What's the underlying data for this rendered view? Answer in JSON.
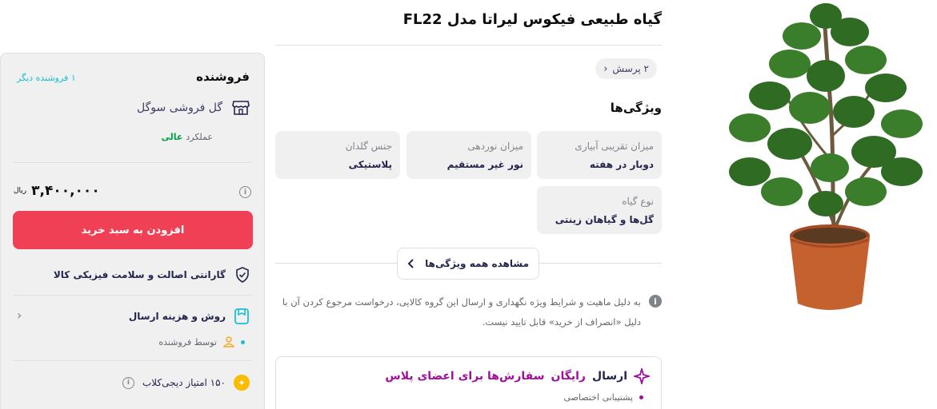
{
  "product": {
    "title": "گیاه طبیعی فیکوس لیراتا مدل FL22",
    "questions_pill": "۲ پرسش",
    "image_alt": "ficus-lyrata-plant-image"
  },
  "specs": {
    "section_title": "ویژگی‌ها",
    "items": [
      {
        "key": "میزان تقریبی آبیاری",
        "value": "دوبار در هفته"
      },
      {
        "key": "میزان نوردهی",
        "value": "نور غیر مستقیم"
      },
      {
        "key": "جنس گلدان",
        "value": "پلاستیکی"
      },
      {
        "key": "نوع گیاه",
        "value": "گل‌ها و گیاهان زینتی"
      }
    ],
    "see_all_label": "مشاهده همه ویژگی‌ها"
  },
  "notice": {
    "text": "به دلیل ماهیت و شرایط ویژه نگهداری و ارسال این گروه کالایی، درخواست مرجوع کردن آن با دلیل «انصراف از خرید» قابل تایید نیست."
  },
  "plus": {
    "heading_prefix": "ارسال",
    "heading_highlight": "رایگان",
    "heading_suffix": "سفارش‌ها برای اعضای پلاس",
    "sub_item": "پشتیبانی اختصاصی"
  },
  "seller": {
    "header": "فروشنده",
    "other_sellers": "۱ فروشنده دیگر",
    "name": "گل فروشی سوگل",
    "performance_label": "عملکرد",
    "performance_value": "عالی",
    "price": "۳,۴۰۰,۰۰۰",
    "currency": "ریال",
    "add_to_cart": "افزودن به سبد خرید",
    "guarantee": "گارانتی اصالت و سلامت فیزیکی کالا",
    "shipping_title": "روش و هزینه ارسال",
    "shipping_by": "توسط فروشنده",
    "club_points": "۱۵۰ امتیاز دیجی‌کلاب"
  },
  "colors": {
    "primary_red": "#ef4056",
    "green": "#00a049",
    "teal_link": "#19bfd3",
    "plus_purple": "#9f0f9e"
  }
}
